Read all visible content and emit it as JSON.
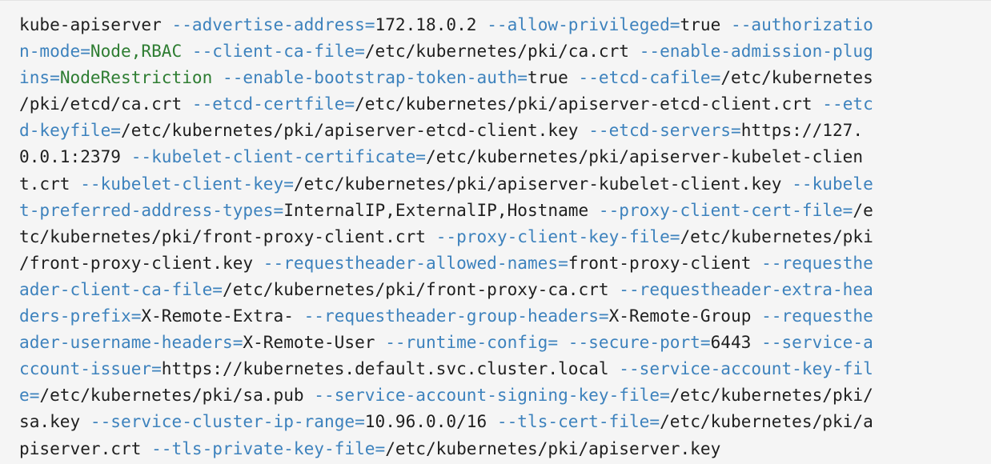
{
  "colors": {
    "background": "#f5f5f5",
    "text": "#1f1f1f",
    "flag": "#3d82bd",
    "green_value": "#2e7d32"
  },
  "code": {
    "lines": [
      [
        {
          "t": "t",
          "x": "kube-apiserver "
        },
        {
          "t": "f",
          "x": "--advertise-address="
        },
        {
          "t": "v",
          "x": "172.18.0.2 "
        },
        {
          "t": "f",
          "x": "--allow-privileged="
        },
        {
          "t": "v",
          "x": "true "
        },
        {
          "t": "f",
          "x": "--authorizatio"
        }
      ],
      [
        {
          "t": "f",
          "x": "n-mode="
        },
        {
          "t": "g",
          "x": "Node,RBAC "
        },
        {
          "t": "f",
          "x": "--client-ca-file="
        },
        {
          "t": "v",
          "x": "/etc/kubernetes/pki/ca.crt "
        },
        {
          "t": "f",
          "x": "--enable-admission-plug"
        }
      ],
      [
        {
          "t": "f",
          "x": "ins="
        },
        {
          "t": "g",
          "x": "NodeRestriction "
        },
        {
          "t": "f",
          "x": "--enable-bootstrap-token-auth="
        },
        {
          "t": "v",
          "x": "true "
        },
        {
          "t": "f",
          "x": "--etcd-cafile="
        },
        {
          "t": "v",
          "x": "/etc/kubernetes"
        }
      ],
      [
        {
          "t": "v",
          "x": "/pki/etcd/ca.crt "
        },
        {
          "t": "f",
          "x": "--etcd-certfile="
        },
        {
          "t": "v",
          "x": "/etc/kubernetes/pki/apiserver-etcd-client.crt "
        },
        {
          "t": "f",
          "x": "--etc"
        }
      ],
      [
        {
          "t": "f",
          "x": "d-keyfile="
        },
        {
          "t": "v",
          "x": "/etc/kubernetes/pki/apiserver-etcd-client.key "
        },
        {
          "t": "f",
          "x": "--etcd-servers="
        },
        {
          "t": "v",
          "x": "https://127."
        }
      ],
      [
        {
          "t": "v",
          "x": "0.0.1:2379 "
        },
        {
          "t": "f",
          "x": "--kubelet-client-certificate="
        },
        {
          "t": "v",
          "x": "/etc/kubernetes/pki/apiserver-kubelet-clien"
        }
      ],
      [
        {
          "t": "v",
          "x": "t.crt "
        },
        {
          "t": "f",
          "x": "--kubelet-client-key="
        },
        {
          "t": "v",
          "x": "/etc/kubernetes/pki/apiserver-kubelet-client.key "
        },
        {
          "t": "f",
          "x": "--kubele"
        }
      ],
      [
        {
          "t": "f",
          "x": "t-preferred-address-types="
        },
        {
          "t": "v",
          "x": "InternalIP,ExternalIP,Hostname "
        },
        {
          "t": "f",
          "x": "--proxy-client-cert-file="
        },
        {
          "t": "v",
          "x": "/e"
        }
      ],
      [
        {
          "t": "v",
          "x": "tc/kubernetes/pki/front-proxy-client.crt "
        },
        {
          "t": "f",
          "x": "--proxy-client-key-file="
        },
        {
          "t": "v",
          "x": "/etc/kubernetes/pki"
        }
      ],
      [
        {
          "t": "v",
          "x": "/front-proxy-client.key "
        },
        {
          "t": "f",
          "x": "--requestheader-allowed-names="
        },
        {
          "t": "v",
          "x": "front-proxy-client "
        },
        {
          "t": "f",
          "x": "--requesthe"
        }
      ],
      [
        {
          "t": "f",
          "x": "ader-client-ca-file="
        },
        {
          "t": "v",
          "x": "/etc/kubernetes/pki/front-proxy-ca.crt "
        },
        {
          "t": "f",
          "x": "--requestheader-extra-hea"
        }
      ],
      [
        {
          "t": "f",
          "x": "ders-prefix="
        },
        {
          "t": "v",
          "x": "X-Remote-Extra- "
        },
        {
          "t": "f",
          "x": "--requestheader-group-headers="
        },
        {
          "t": "v",
          "x": "X-Remote-Group "
        },
        {
          "t": "f",
          "x": "--requesthe"
        }
      ],
      [
        {
          "t": "f",
          "x": "ader-username-headers="
        },
        {
          "t": "v",
          "x": "X-Remote-User "
        },
        {
          "t": "f",
          "x": "--runtime-config= --secure-port="
        },
        {
          "t": "v",
          "x": "6443 "
        },
        {
          "t": "f",
          "x": "--service-a"
        }
      ],
      [
        {
          "t": "f",
          "x": "ccount-issuer="
        },
        {
          "t": "v",
          "x": "https://kubernetes.default.svc.cluster.local "
        },
        {
          "t": "f",
          "x": "--service-account-key-fil"
        }
      ],
      [
        {
          "t": "f",
          "x": "e="
        },
        {
          "t": "v",
          "x": "/etc/kubernetes/pki/sa.pub "
        },
        {
          "t": "f",
          "x": "--service-account-signing-key-file="
        },
        {
          "t": "v",
          "x": "/etc/kubernetes/pki/"
        }
      ],
      [
        {
          "t": "v",
          "x": "sa.key "
        },
        {
          "t": "f",
          "x": "--service-cluster-ip-range="
        },
        {
          "t": "v",
          "x": "10.96.0.0/16 "
        },
        {
          "t": "f",
          "x": "--tls-cert-file="
        },
        {
          "t": "v",
          "x": "/etc/kubernetes/pki/a"
        }
      ],
      [
        {
          "t": "v",
          "x": "piserver.crt "
        },
        {
          "t": "f",
          "x": "--tls-private-key-file="
        },
        {
          "t": "v",
          "x": "/etc/kubernetes/pki/apiserver.key"
        }
      ]
    ]
  }
}
